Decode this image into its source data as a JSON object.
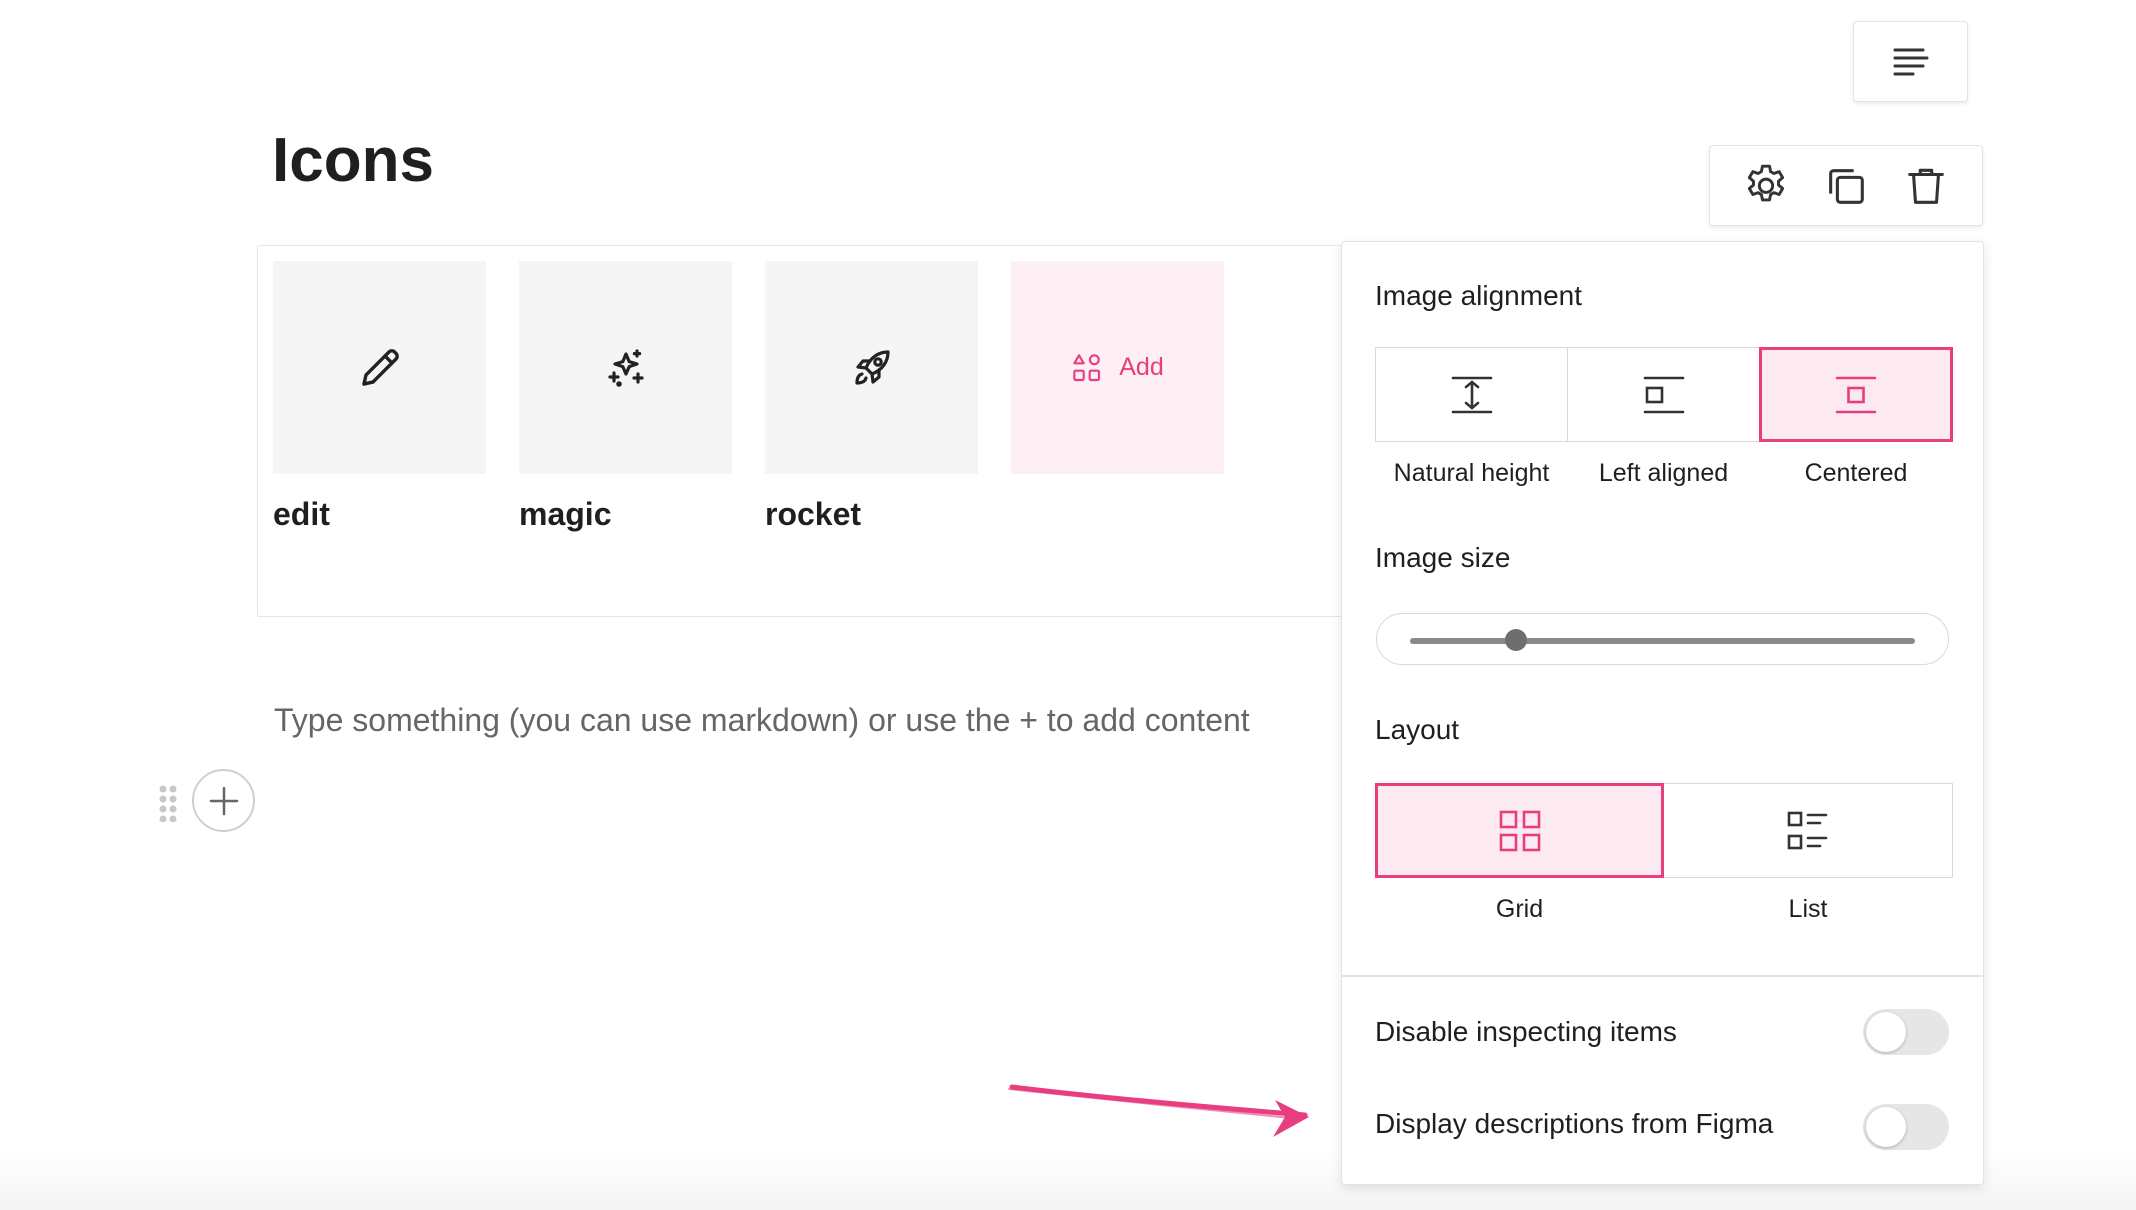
{
  "page": {
    "title": "Icons"
  },
  "colors": {
    "accent": "#e83e80",
    "accent_bg": "#fdeaf1",
    "tile_bg": "#f5f5f5"
  },
  "toolbar": {
    "icons": [
      "gear-icon",
      "duplicate-icon",
      "trash-icon"
    ]
  },
  "icons_block": {
    "tiles": [
      {
        "icon": "pencil-icon",
        "label": "edit"
      },
      {
        "icon": "sparkles-icon",
        "label": "magic"
      },
      {
        "icon": "rocket-icon",
        "label": "rocket"
      }
    ],
    "add_label": "Add"
  },
  "editor": {
    "placeholder": "Type something (you can use markdown) or use the + to add content"
  },
  "settings": {
    "image_alignment": {
      "title": "Image alignment",
      "options": [
        "Natural height",
        "Left aligned",
        "Centered"
      ],
      "selected": "Centered"
    },
    "image_size": {
      "title": "Image size",
      "value_fraction": 0.21
    },
    "layout": {
      "title": "Layout",
      "options": [
        "Grid",
        "List"
      ],
      "selected": "Grid"
    },
    "toggles": [
      {
        "label": "Disable inspecting items",
        "on": false
      },
      {
        "label": "Display descriptions from Figma",
        "on": false
      }
    ]
  }
}
